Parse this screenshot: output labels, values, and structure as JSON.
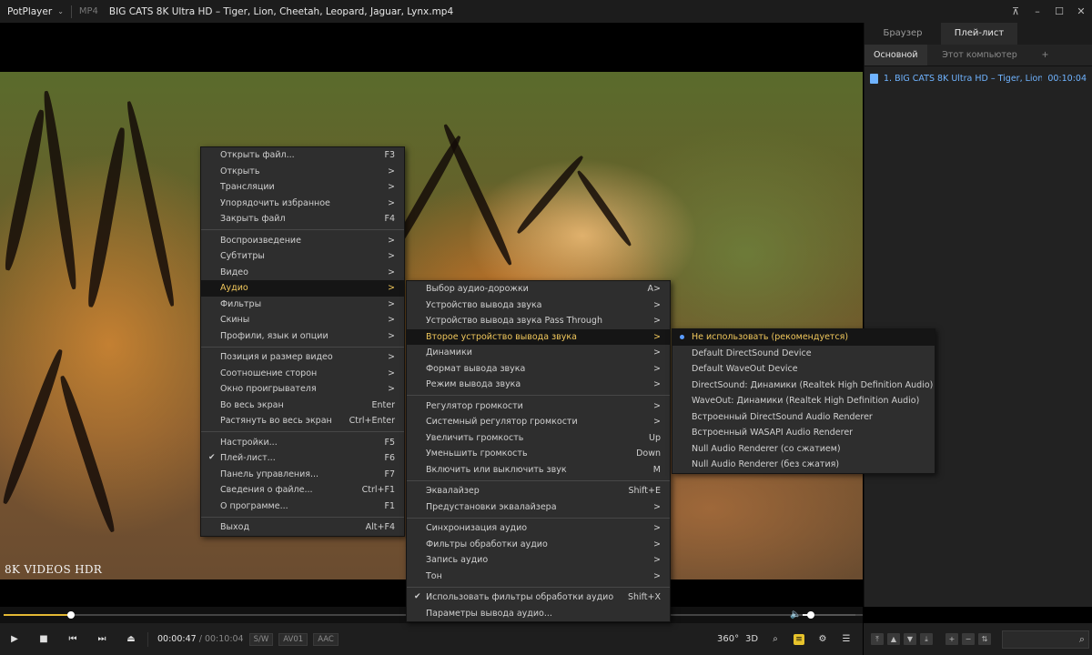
{
  "window": {
    "app_name": "PotPlayer",
    "format": "MP4",
    "title": "BIG CATS 8K Ultra HD – Tiger, Lion, Cheetah, Leopard, Jaguar, Lynx.mp4"
  },
  "video": {
    "watermark": "8K VIDEOS HDR"
  },
  "panel": {
    "tabs": [
      "Браузер",
      "Плей-лист"
    ],
    "active_tab": 1,
    "subtabs": [
      "Основной",
      "Этот компьютер",
      "+"
    ],
    "playlist": [
      {
        "name": "1. BIG CATS 8K Ultra HD – Tiger, Lion, Che...",
        "duration": "00:10:04"
      }
    ]
  },
  "playback": {
    "current": "00:00:47",
    "separator": "/",
    "total": "00:10:04",
    "badges": [
      "S/W",
      "AV01",
      "AAC"
    ],
    "progress": 0.078,
    "volume": 0.15
  },
  "icons": {
    "play": "play-icon",
    "stop": "stop-icon",
    "prev": "previous-icon",
    "next": "next-icon",
    "eject": "eject-icon",
    "settings": "gear-icon",
    "menu": "hamburger-icon",
    "search": "search-icon"
  },
  "right_controls": {
    "vr": "360°",
    "stereo": "3D"
  },
  "main_menu": [
    {
      "label": "Открыть файл...",
      "shortcut": "F3"
    },
    {
      "label": "Открыть",
      "shortcut": ">"
    },
    {
      "label": "Трансляции",
      "shortcut": ">"
    },
    {
      "label": "Упорядочить избранное",
      "shortcut": ">"
    },
    {
      "label": "Закрыть файл",
      "shortcut": "F4"
    },
    {
      "sep": true
    },
    {
      "label": "Воспроизведение",
      "shortcut": ">"
    },
    {
      "label": "Субтитры",
      "shortcut": ">"
    },
    {
      "label": "Видео",
      "shortcut": ">"
    },
    {
      "label": "Аудио",
      "shortcut": ">",
      "highlight": true
    },
    {
      "label": "Фильтры",
      "shortcut": ">"
    },
    {
      "label": "Скины",
      "shortcut": ">"
    },
    {
      "label": "Профили, язык и опции",
      "shortcut": ">"
    },
    {
      "sep": true
    },
    {
      "label": "Позиция и размер видео",
      "shortcut": ">"
    },
    {
      "label": "Соотношение сторон",
      "shortcut": ">"
    },
    {
      "label": "Окно проигрывателя",
      "shortcut": ">"
    },
    {
      "label": "Во весь экран",
      "shortcut": "Enter"
    },
    {
      "label": "Растянуть во весь экран",
      "shortcut": "Ctrl+Enter"
    },
    {
      "sep": true
    },
    {
      "label": "Настройки...",
      "shortcut": "F5"
    },
    {
      "label": "Плей-лист...",
      "shortcut": "F6",
      "checked": true
    },
    {
      "label": "Панель управления...",
      "shortcut": "F7"
    },
    {
      "label": "Сведения о файле...",
      "shortcut": "Ctrl+F1"
    },
    {
      "label": "О программе...",
      "shortcut": "F1"
    },
    {
      "sep": true
    },
    {
      "label": "Выход",
      "shortcut": "Alt+F4"
    }
  ],
  "audio_menu": [
    {
      "label": "Выбор аудио-дорожки",
      "shortcut": "A>"
    },
    {
      "label": "Устройство вывода звука",
      "shortcut": ">"
    },
    {
      "label": "Устройство вывода звука Pass Through",
      "shortcut": ">"
    },
    {
      "label": "Второе устройство вывода звука",
      "shortcut": ">",
      "highlight": true
    },
    {
      "label": "Динамики",
      "shortcut": ">"
    },
    {
      "label": "Формат вывода звука",
      "shortcut": ">"
    },
    {
      "label": "Режим вывода звука",
      "shortcut": ">"
    },
    {
      "sep": true
    },
    {
      "label": "Регулятор громкости",
      "shortcut": ">"
    },
    {
      "label": "Системный регулятор громкости",
      "shortcut": ">"
    },
    {
      "label": "Увеличить громкость",
      "shortcut": "Up"
    },
    {
      "label": "Уменьшить громкость",
      "shortcut": "Down"
    },
    {
      "label": "Включить или выключить звук",
      "shortcut": "M"
    },
    {
      "sep": true
    },
    {
      "label": "Эквалайзер",
      "shortcut": "Shift+E"
    },
    {
      "label": "Предустановки эквалайзера",
      "shortcut": ">"
    },
    {
      "sep": true
    },
    {
      "label": "Синхронизация аудио",
      "shortcut": ">"
    },
    {
      "label": "Фильтры обработки аудио",
      "shortcut": ">"
    },
    {
      "label": "Запись аудио",
      "shortcut": ">"
    },
    {
      "label": "Тон",
      "shortcut": ">"
    },
    {
      "sep": true
    },
    {
      "label": "Использовать фильтры обработки аудио",
      "shortcut": "Shift+X",
      "checked": true
    },
    {
      "label": "Параметры вывода аудио...",
      "shortcut": ""
    }
  ],
  "device_menu": [
    {
      "label": "Не использовать (рекомендуется)",
      "selected": true,
      "highlight": true
    },
    {
      "label": "Default DirectSound Device"
    },
    {
      "label": "Default WaveOut Device"
    },
    {
      "label": "DirectSound: Динамики (Realtek High Definition Audio)"
    },
    {
      "label": "WaveOut: Динамики (Realtek High Definition Audio)"
    },
    {
      "label": "Встроенный DirectSound Audio Renderer"
    },
    {
      "label": "Встроенный WASAPI Audio Renderer"
    },
    {
      "label": "Null Audio Renderer (со сжатием)"
    },
    {
      "label": "Null Audio Renderer (без сжатия)"
    }
  ]
}
